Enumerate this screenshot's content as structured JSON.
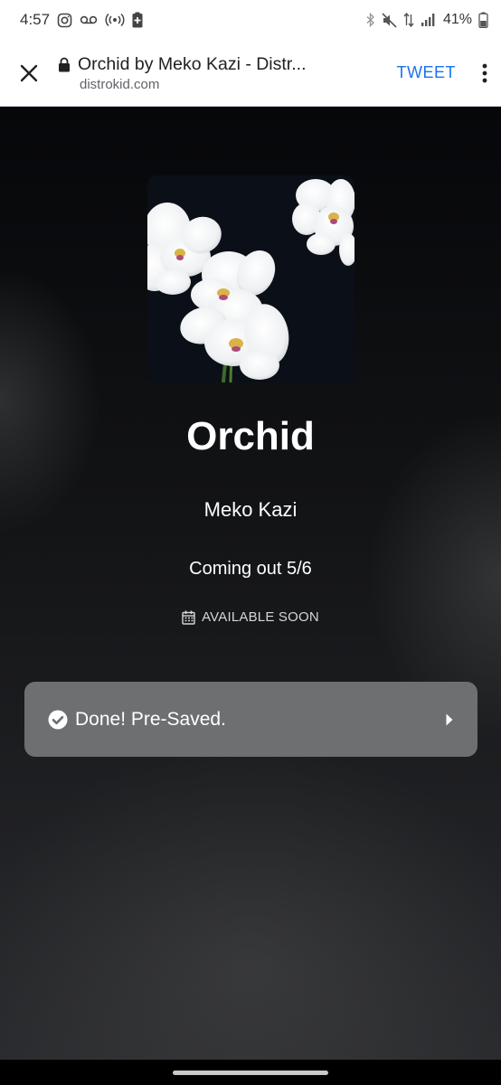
{
  "status_bar": {
    "time": "4:57",
    "battery": "41%",
    "icons_left": [
      "instagram-icon",
      "voicemail-icon",
      "hotspot-icon",
      "battery-saver-icon"
    ],
    "icons_right": [
      "bluetooth-icon",
      "mute-icon",
      "data-icon",
      "signal-icon",
      "battery-icon"
    ]
  },
  "browser": {
    "page_title": "Orchid by Meko Kazi - Distr...",
    "domain": "distrokid.com",
    "tweet_label": "TWEET",
    "accent_color": "#1a73e8"
  },
  "release": {
    "title": "Orchid",
    "artist": "Meko Kazi",
    "release_text": "Coming out 5/6",
    "availability": "AVAILABLE SOON",
    "presave_label": "Done! Pre-Saved."
  }
}
